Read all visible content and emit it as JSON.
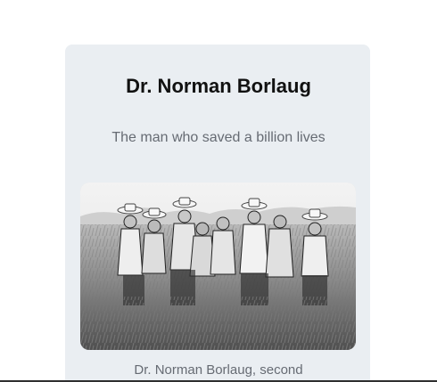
{
  "article": {
    "title": "Dr. Norman Borlaug",
    "subtitle": "The man who saved a billion lives",
    "caption": "Dr. Norman Borlaug, second"
  },
  "colors": {
    "card_background": "#eaeef2",
    "title": "#111111",
    "muted_text": "#666b73"
  },
  "icons": {
    "photo": "field-workers-photo"
  }
}
